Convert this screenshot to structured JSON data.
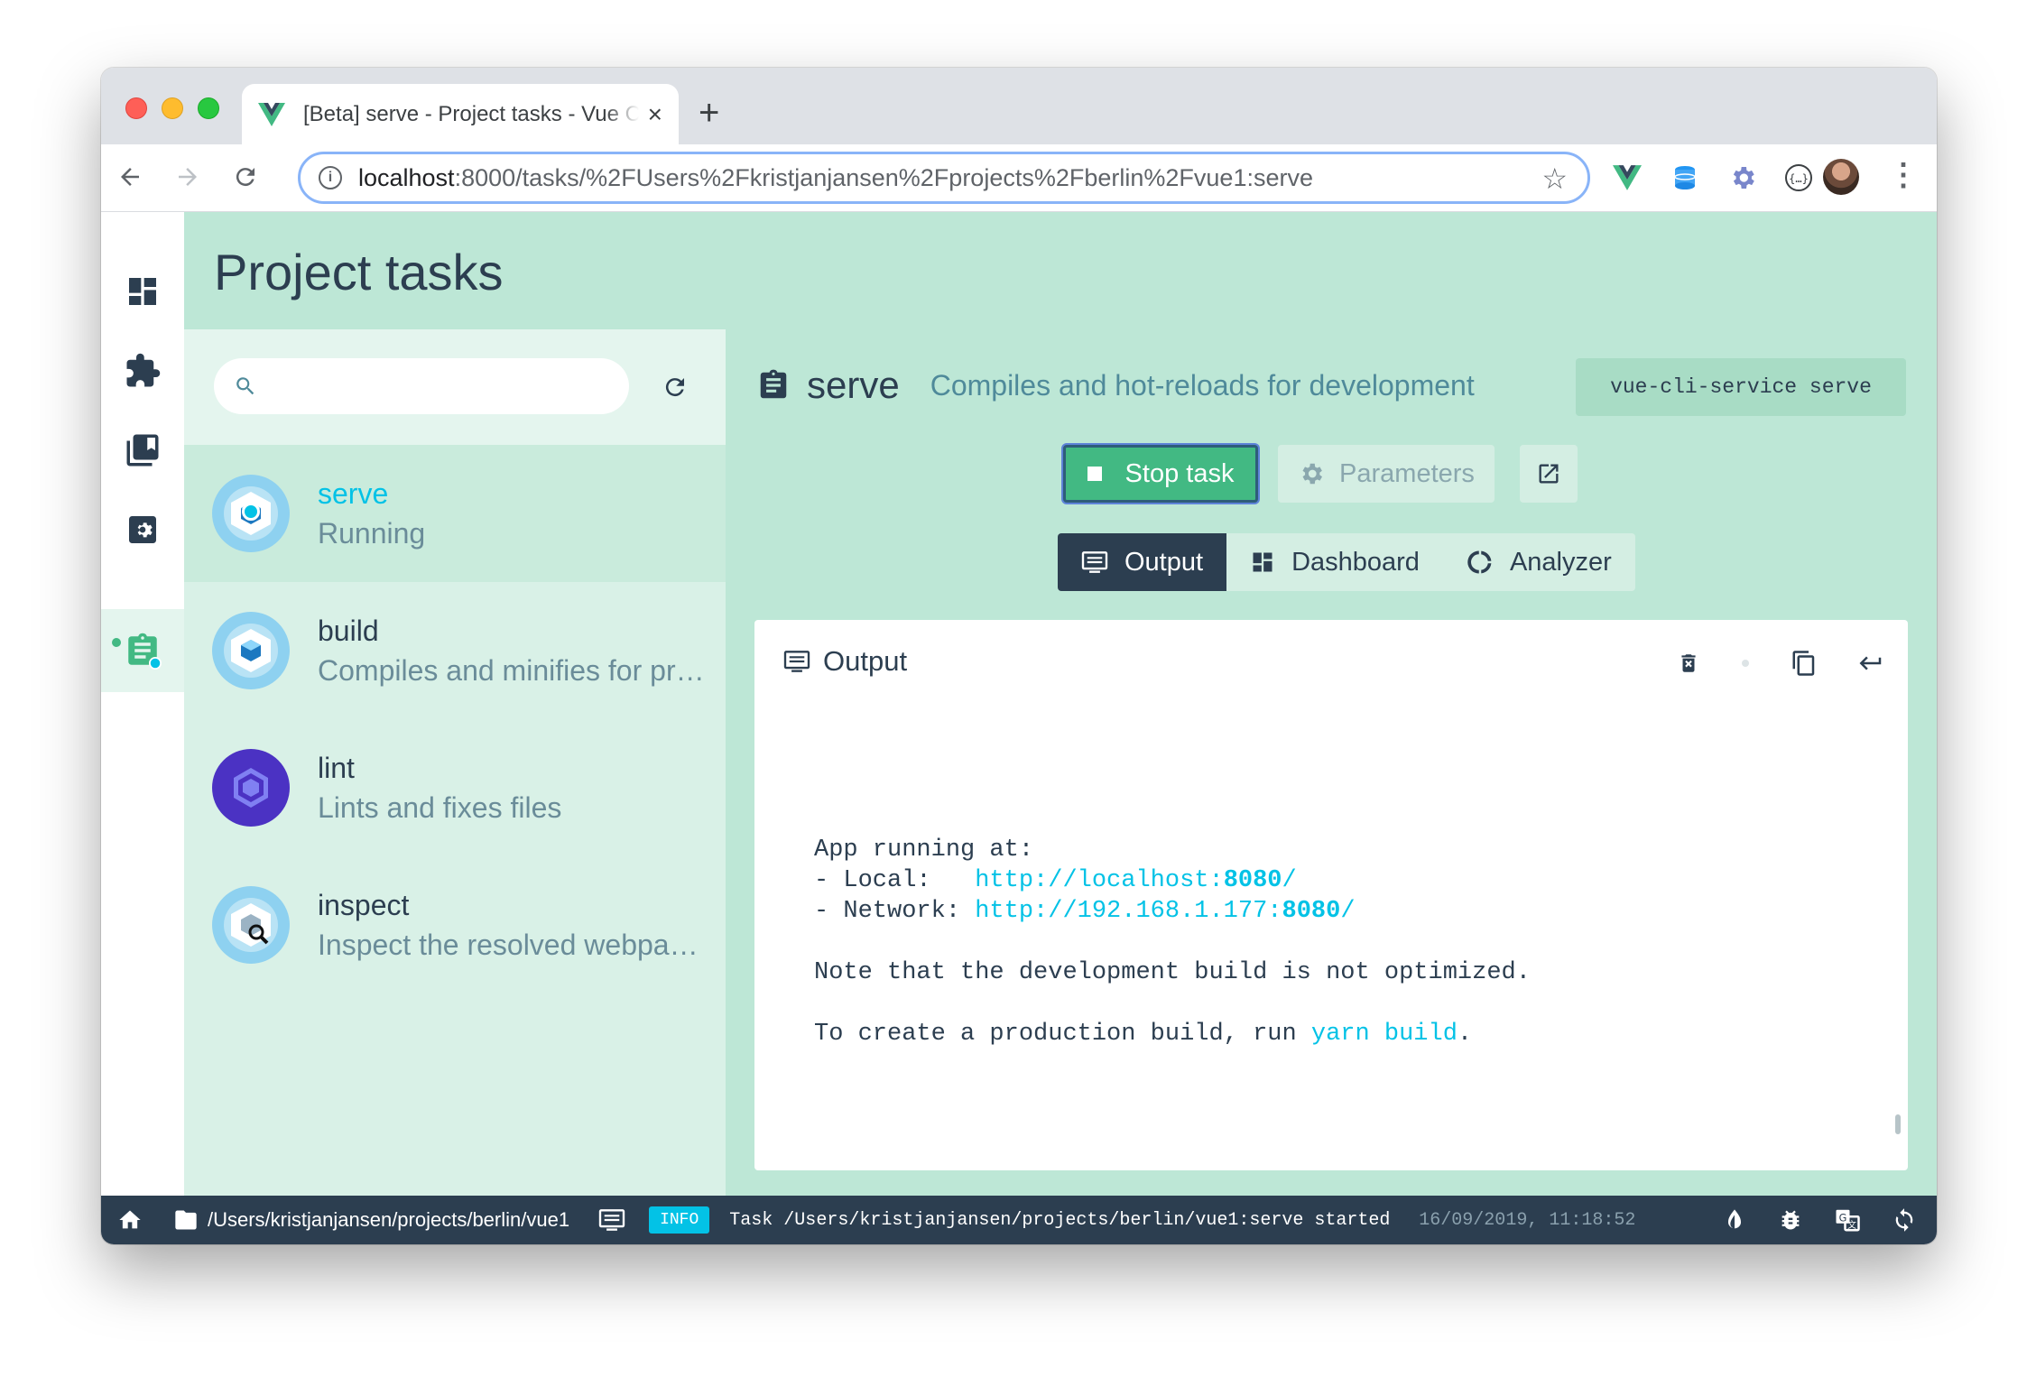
{
  "browser": {
    "tab_title": "[Beta] serve - Project tasks - Vue CLI",
    "tab_close": "×",
    "new_tab": "+",
    "url_host": "localhost",
    "url_rest": ":8000/tasks/%2FUsers%2Fkristjanjansen%2Fprojects%2Fberlin%2Fvue1:serve",
    "extensions": [
      "vue-devtools-icon",
      "database-icon",
      "gear-extension-icon",
      "json-icon",
      "react-icon"
    ]
  },
  "sidebar_nav": {
    "items": [
      "dashboard-icon",
      "plugins-icon",
      "dependencies-icon",
      "configuration-icon",
      "tasks-icon"
    ],
    "active": "tasks-icon"
  },
  "header": {
    "title": "Project tasks"
  },
  "search": {
    "placeholder": ""
  },
  "tasks": [
    {
      "name": "serve",
      "description": "Running",
      "icon": "webpack-icon",
      "selected": true
    },
    {
      "name": "build",
      "description": "Compiles and minifies for production",
      "icon": "webpack-icon",
      "selected": false
    },
    {
      "name": "lint",
      "description": "Lints and fixes files",
      "icon": "eslint-icon",
      "selected": false
    },
    {
      "name": "inspect",
      "description": "Inspect the resolved webpack config",
      "icon": "webpack-inspect-icon",
      "selected": false
    }
  ],
  "task_detail": {
    "name": "serve",
    "description": "Compiles and hot-reloads for development",
    "command": "vue-cli-service serve",
    "stop_label": "Stop task",
    "params_label": "Parameters",
    "views": [
      {
        "label": "Output",
        "active": true
      },
      {
        "label": "Dashboard",
        "active": false
      },
      {
        "label": "Analyzer",
        "active": false
      }
    ]
  },
  "output": {
    "title": "Output",
    "lines": {
      "l1": "App running at:",
      "l2_prefix": "- Local:   ",
      "l2_link_a": "http://localhost:",
      "l2_link_b": "8080",
      "l2_link_c": "/",
      "l3_prefix": "- Network: ",
      "l3_link_a": "http://192.168.1.177:",
      "l3_link_b": "8080",
      "l3_link_c": "/",
      "l4": "Note that the development build is not optimized.",
      "l5_prefix": "To create a production build, run ",
      "l5_cmd": "yarn build",
      "l5_suffix": "."
    }
  },
  "statusbar": {
    "path": "/Users/kristjanjansen/projects/berlin/vue1",
    "level": "INFO",
    "log": "Task /Users/kristjanjansen/projects/berlin/vue1:serve started",
    "time": "16/09/2019, 11:18:52"
  },
  "colors": {
    "accent": "#42b983",
    "header_bg": "#bde7d6",
    "dark": "#2c3e50",
    "link": "#03c2e6"
  }
}
